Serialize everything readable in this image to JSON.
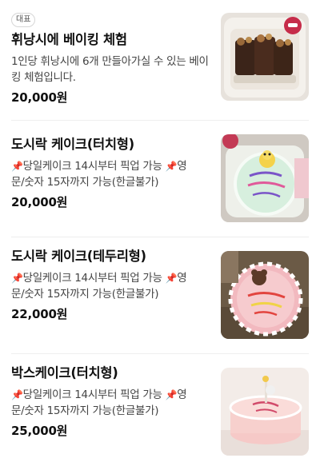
{
  "items": [
    {
      "badge": "대표",
      "title": "휘낭시에 베이킹 체험",
      "desc": "1인당 휘낭시에 6개 만들아가실 수 있는 베이킹 체험입니다.",
      "price": "20,000원",
      "image_icon": "brownie-box-photo"
    },
    {
      "title": "도시락 케이크(터치형)",
      "desc_line1": "당일케이크 14시부터 픽업 가능 ",
      "desc_line1b": "영",
      "desc_line2": "문/숫자 15자까지 가능(한글불가)",
      "price": "20,000원",
      "pin_icon": "pushpin",
      "image_icon": "mint-lunchbox-cake-photo"
    },
    {
      "title": "도시락 케이크(테두리형)",
      "desc_line1": "당일케이크 14시부터 픽업 가능 ",
      "desc_line1b": "영",
      "desc_line2": "문/숫자 15자까지 가능(한글불가)",
      "price": "22,000원",
      "pin_icon": "pushpin",
      "image_icon": "pink-border-cake-photo"
    },
    {
      "title": "박스케이크(터치형)",
      "desc_line1": "당일케이크 14시부터 픽업 가능 ",
      "desc_line1b": "영",
      "desc_line2": "문/숫자 15자까지 가능(한글불가)",
      "price": "25,000원",
      "pin_icon": "pushpin",
      "image_icon": "pink-box-cake-photo"
    }
  ],
  "colors": {
    "pin": "#d63a3a",
    "divider": "#eeeeee",
    "text": "#111111"
  }
}
